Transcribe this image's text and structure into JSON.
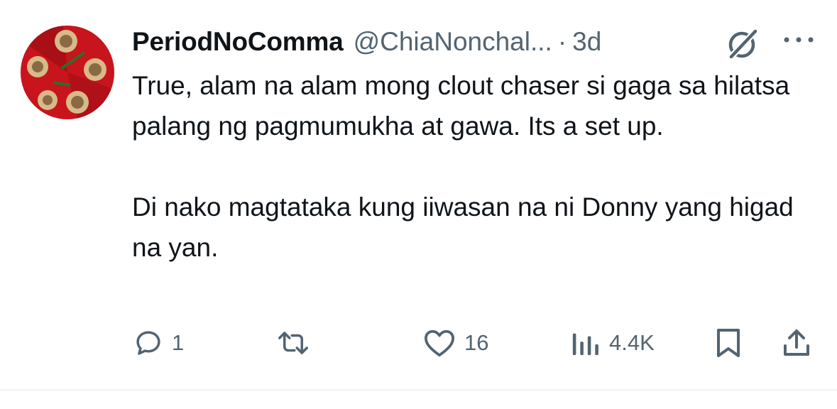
{
  "tweet": {
    "display_name": "PeriodNoComma",
    "handle": "@ChiaNonchal...",
    "separator": "·",
    "time": "3d",
    "avatar_icon": "profile-photo",
    "header_icons": [
      "grok-icon",
      "more-icon"
    ],
    "text": "True, alam na alam mong clout chaser si gaga sa hilatsa palang ng pagmumukha at gawa. Its a set up.\n\nDi nako magtataka kung iiwasan na ni Donny yang higad na yan.",
    "actions": {
      "reply": {
        "icon": "reply-icon",
        "count": "1"
      },
      "retweet": {
        "icon": "retweet-icon",
        "count": ""
      },
      "like": {
        "icon": "heart-icon",
        "count": "16"
      },
      "views": {
        "icon": "views-icon",
        "count": "4.4K"
      },
      "bookmark": {
        "icon": "bookmark-icon"
      },
      "share": {
        "icon": "share-icon"
      }
    }
  },
  "colors": {
    "text_primary": "#0f1419",
    "text_secondary": "#536471",
    "divider": "#eff3f4",
    "avatar_red": "#c8141c"
  }
}
